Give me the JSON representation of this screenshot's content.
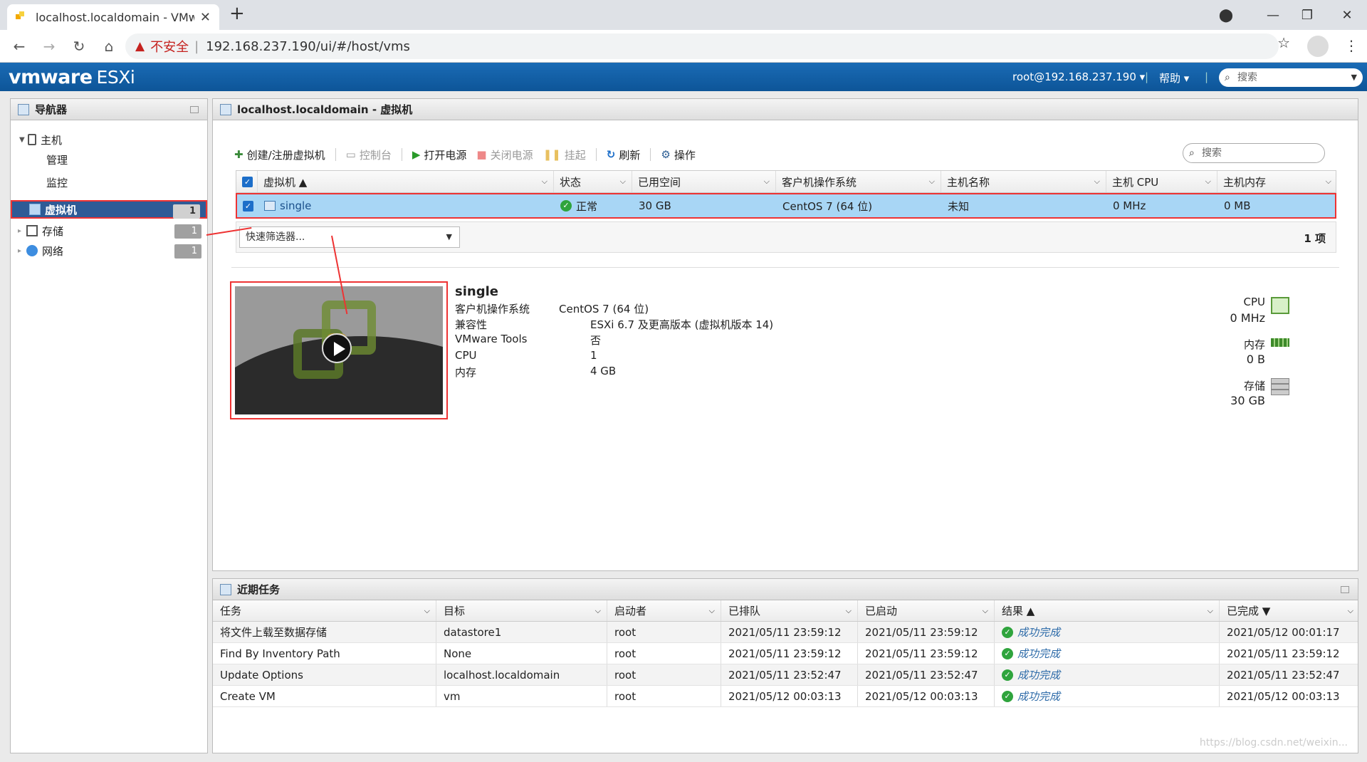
{
  "browser": {
    "tab_title": "localhost.localdomain - VMware",
    "url": "192.168.237.190/ui/#/host/vms",
    "insecure_label": "不安全"
  },
  "header": {
    "logo_brand": "vmware",
    "logo_product": "ESXi",
    "user": "root@192.168.237.190 ▾",
    "help": "帮助 ▾",
    "search_placeholder": "搜索"
  },
  "navigator": {
    "title": "导航器",
    "host_label": "主机",
    "host_children": [
      "管理",
      "监控"
    ],
    "items": [
      {
        "label": "虚拟机",
        "count": "1"
      },
      {
        "label": "存储",
        "count": "1"
      },
      {
        "label": "网络",
        "count": "1"
      }
    ]
  },
  "main": {
    "title": "localhost.localdomain - 虚拟机",
    "toolbar": {
      "create": "创建/注册虚拟机",
      "console": "控制台",
      "power_on": "打开电源",
      "power_off": "关闭电源",
      "suspend": "挂起",
      "refresh": "刷新",
      "actions": "操作"
    },
    "search_placeholder": "搜索",
    "columns": [
      "虚拟机 ▲",
      "状态",
      "已用空间",
      "客户机操作系统",
      "主机名称",
      "主机 CPU",
      "主机内存"
    ],
    "row": {
      "name": "single",
      "status": "正常",
      "used_space": "30 GB",
      "guest_os": "CentOS 7 (64 位)",
      "hostname": "未知",
      "host_cpu": "0 MHz",
      "host_mem": "0 MB"
    },
    "quick_filter": "快速筛选器...",
    "item_count": "1 项",
    "detail": {
      "name": "single",
      "props": [
        {
          "label": "客户机操作系统",
          "value": "CentOS 7 (64 位)"
        },
        {
          "label": "兼容性",
          "value": "ESXi 6.7 及更高版本 (虚拟机版本 14)"
        },
        {
          "label": "VMware Tools",
          "value": "否"
        },
        {
          "label": "CPU",
          "value": "1"
        },
        {
          "label": "内存",
          "value": "4 GB"
        }
      ],
      "resources": [
        {
          "label": "CPU",
          "value": "0 MHz"
        },
        {
          "label": "内存",
          "value": "0 B"
        },
        {
          "label": "存储",
          "value": "30 GB"
        }
      ]
    }
  },
  "tasks": {
    "title": "近期任务",
    "columns": [
      "任务",
      "目标",
      "启动者",
      "已排队",
      "已启动",
      "结果 ▲",
      "已完成 ▼"
    ],
    "rows": [
      {
        "task": "将文件上载至数据存储",
        "target": "datastore1",
        "initiator": "root",
        "queued": "2021/05/11 23:59:12",
        "started": "2021/05/11 23:59:12",
        "result": "成功完成",
        "completed": "2021/05/12 00:01:17"
      },
      {
        "task": "Find By Inventory Path",
        "target": "None",
        "initiator": "root",
        "queued": "2021/05/11 23:59:12",
        "started": "2021/05/11 23:59:12",
        "result": "成功完成",
        "completed": "2021/05/11 23:59:12"
      },
      {
        "task": "Update Options",
        "target": "localhost.localdomain",
        "initiator": "root",
        "queued": "2021/05/11 23:52:47",
        "started": "2021/05/11 23:52:47",
        "result": "成功完成",
        "completed": "2021/05/11 23:52:47"
      },
      {
        "task": "Create VM",
        "target": "vm",
        "initiator": "root",
        "queued": "2021/05/12 00:03:13",
        "started": "2021/05/12 00:03:13",
        "result": "成功完成",
        "completed": "2021/05/12 00:03:13"
      }
    ]
  },
  "watermark": "https://blog.csdn.net/weixin..."
}
